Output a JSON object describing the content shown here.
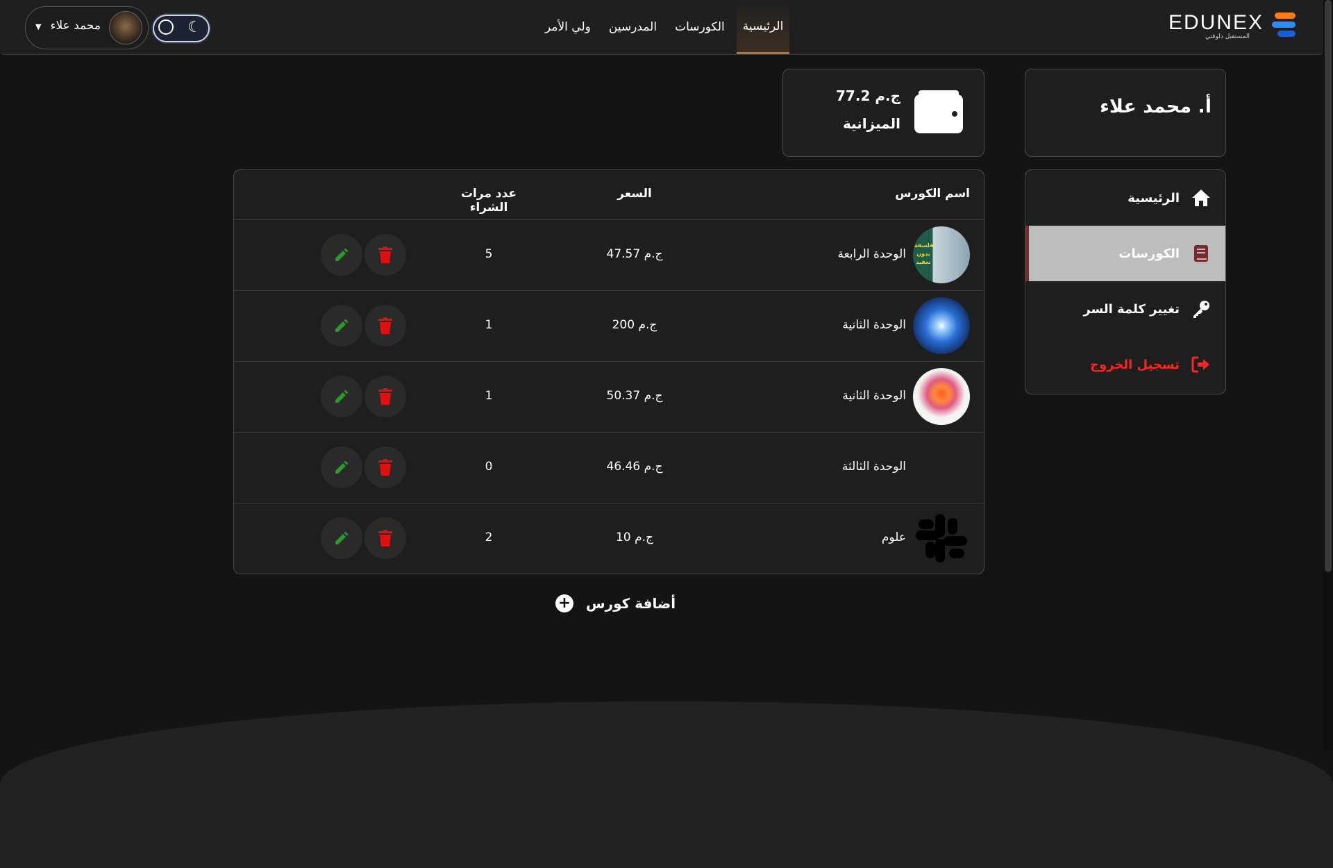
{
  "header": {
    "logo_text": "EDUNEX",
    "logo_tagline": "المستقبل دلوقتي",
    "nav": [
      {
        "label": "الرئيسية",
        "active": true
      },
      {
        "label": "الكورسات",
        "active": false
      },
      {
        "label": "المدرسين",
        "active": false
      },
      {
        "label": "ولي الأمر",
        "active": false
      }
    ],
    "user_name": "محمد علاء",
    "theme_toggle_icon": "moon-icon"
  },
  "profile": {
    "name": "أ. محمد علاء"
  },
  "wallet": {
    "amount": "77.2 ج.م",
    "label": "الميزانية"
  },
  "menu": {
    "items": [
      {
        "label": "الرئيسية",
        "icon": "home-icon"
      },
      {
        "label": "الكورسات",
        "icon": "book-icon",
        "active": true
      },
      {
        "label": "تغيير كلمة السر",
        "icon": "key-icon"
      },
      {
        "label": "تسجيل الخروج",
        "icon": "logout-icon",
        "color": "#ff2222"
      }
    ]
  },
  "table": {
    "headers": {
      "name": "اسم الكورس",
      "price": "السعر",
      "purchases": "عدد مرات الشراء"
    },
    "rows": [
      {
        "name": "الوحدة الرابعة",
        "price": "47.57 ج.م",
        "purchases": "5",
        "thumb_text": "فلسفة بدون تعقيد"
      },
      {
        "name": "الوحدة الثانية",
        "price": "200 ج.م",
        "purchases": "1",
        "thumb_text": ""
      },
      {
        "name": "الوحدة الثانية",
        "price": "50.37 ج.م",
        "purchases": "1",
        "thumb_text": ""
      },
      {
        "name": "الوحدة الثالثة",
        "price": "46.46 ج.م",
        "purchases": "0",
        "thumb_text": ""
      },
      {
        "name": "علوم",
        "price": "10 ج.م",
        "purchases": "2",
        "thumb_text": ""
      }
    ]
  },
  "add_course": {
    "label": "أضافة كورس"
  },
  "colors": {
    "background": "#141414",
    "card": "#1e1e1e",
    "accent": "#b8752f",
    "delete": "#e01010",
    "edit": "#2a9a2a",
    "logout": "#ff2222"
  }
}
